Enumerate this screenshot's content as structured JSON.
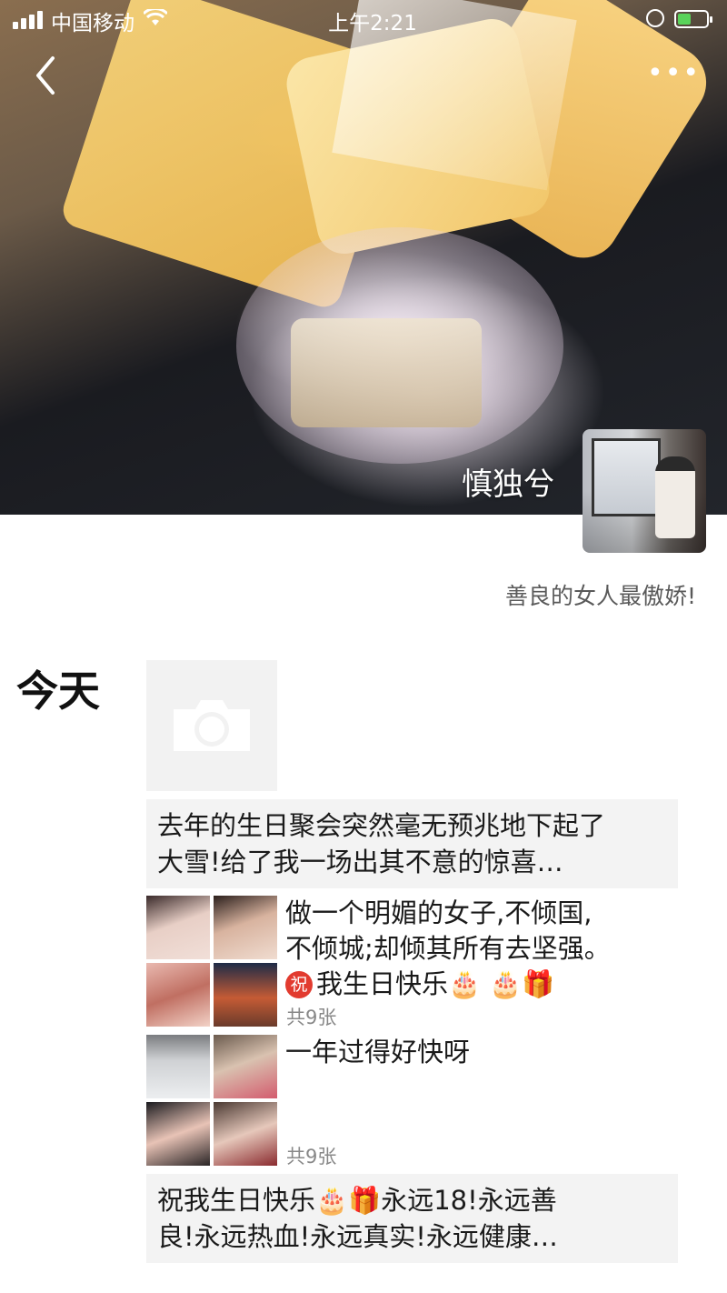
{
  "status_bar": {
    "carrier": "中国移动",
    "time": "上午2:21",
    "battery_level": 0.45,
    "battery_color": "#5ad35a"
  },
  "nav": {
    "back_icon": "chevron-left-icon",
    "more_label": "•••"
  },
  "profile": {
    "username": "慎独兮",
    "signature": "善良的女人最傲娇!"
  },
  "feed": {
    "date_label": "今天",
    "camera_icon": "camera-icon",
    "posts": [
      {
        "text_line1": "去年的生日聚会突然毫无预兆地下起了",
        "text_line2": "大雪!给了我一场出其不意的惊喜…"
      },
      {
        "text_line1": "做一个明媚的女子,不倾国,",
        "text_line2": "不倾城;却倾其所有去坚强。",
        "text_line3_badge": "祝",
        "text_line3": "我生日快乐🎂 🎂🎁",
        "count": "共9张"
      },
      {
        "text": "一年过得好快呀",
        "count": "共9张"
      },
      {
        "text_line1": "祝我生日快乐🎂🎁永远18!永远善",
        "text_line2": "良!永远热血!永远真实!永远健康…"
      }
    ]
  }
}
